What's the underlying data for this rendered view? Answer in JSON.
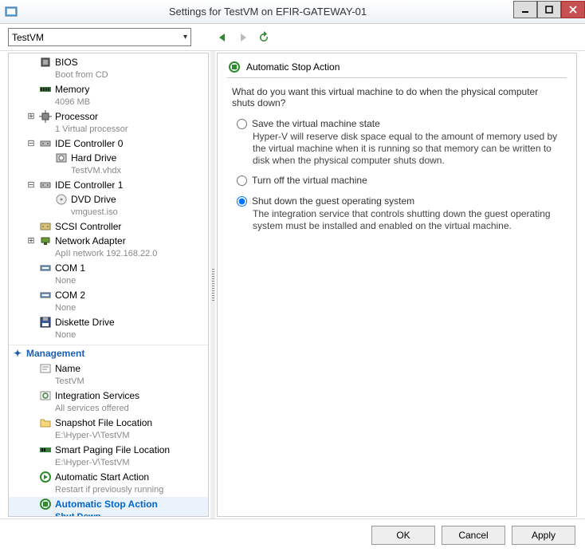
{
  "window": {
    "title": "Settings for TestVM on EFIR-GATEWAY-01"
  },
  "toolbar": {
    "vm_selected": "TestVM"
  },
  "tree": {
    "hardware": [
      {
        "label": "BIOS",
        "sub": "Boot from CD",
        "icon": "chip-icon",
        "expander": ""
      },
      {
        "label": "Memory",
        "sub": "4096 MB",
        "icon": "memory-icon",
        "expander": ""
      },
      {
        "label": "Processor",
        "sub": "1 Virtual processor",
        "icon": "cpu-icon",
        "expander": "+"
      },
      {
        "label": "IDE Controller 0",
        "sub": "",
        "icon": "controller-icon",
        "expander": "-",
        "children": [
          {
            "label": "Hard Drive",
            "sub": "TestVM.vhdx",
            "icon": "disk-icon"
          }
        ]
      },
      {
        "label": "IDE Controller 1",
        "sub": "",
        "icon": "controller-icon",
        "expander": "-",
        "children": [
          {
            "label": "DVD Drive",
            "sub": "vmguest.iso",
            "icon": "dvd-icon"
          }
        ]
      },
      {
        "label": "SCSI Controller",
        "sub": "",
        "icon": "scsi-icon",
        "expander": ""
      },
      {
        "label": "Network Adapter",
        "sub": "ApII network 192.168.22.0",
        "icon": "network-icon",
        "expander": "+"
      },
      {
        "label": "COM 1",
        "sub": "None",
        "icon": "com-icon",
        "expander": ""
      },
      {
        "label": "COM 2",
        "sub": "None",
        "icon": "com-icon",
        "expander": ""
      },
      {
        "label": "Diskette Drive",
        "sub": "None",
        "icon": "floppy-icon",
        "expander": ""
      }
    ],
    "management_header": "Management",
    "management": [
      {
        "label": "Name",
        "sub": "TestVM",
        "icon": "name-icon"
      },
      {
        "label": "Integration Services",
        "sub": "All services offered",
        "icon": "services-icon"
      },
      {
        "label": "Snapshot File Location",
        "sub": "E:\\Hyper-V\\TestVM",
        "icon": "folder-icon"
      },
      {
        "label": "Smart Paging File Location",
        "sub": "E:\\Hyper-V\\TestVM",
        "icon": "paging-icon"
      },
      {
        "label": "Automatic Start Action",
        "sub": "Restart if previously running",
        "icon": "start-icon"
      },
      {
        "label": "Automatic Stop Action",
        "sub": "Shut Down",
        "icon": "stop-icon",
        "selected": true
      }
    ]
  },
  "panel": {
    "title": "Automatic Stop Action",
    "question": "What do you want this virtual machine to do when the physical computer shuts down?",
    "options": [
      {
        "label": "Save the virtual machine state",
        "desc": "Hyper-V will reserve disk space equal to the amount of memory used by the virtual machine when it is running so that memory can be written to disk when the physical computer shuts down.",
        "checked": false
      },
      {
        "label": "Turn off the virtual machine",
        "desc": "",
        "checked": false
      },
      {
        "label": "Shut down the guest operating system",
        "desc": "The integration service that controls shutting down the guest operating system must be installed and enabled on the virtual machine.",
        "checked": true
      }
    ]
  },
  "buttons": {
    "ok": "OK",
    "cancel": "Cancel",
    "apply": "Apply"
  }
}
